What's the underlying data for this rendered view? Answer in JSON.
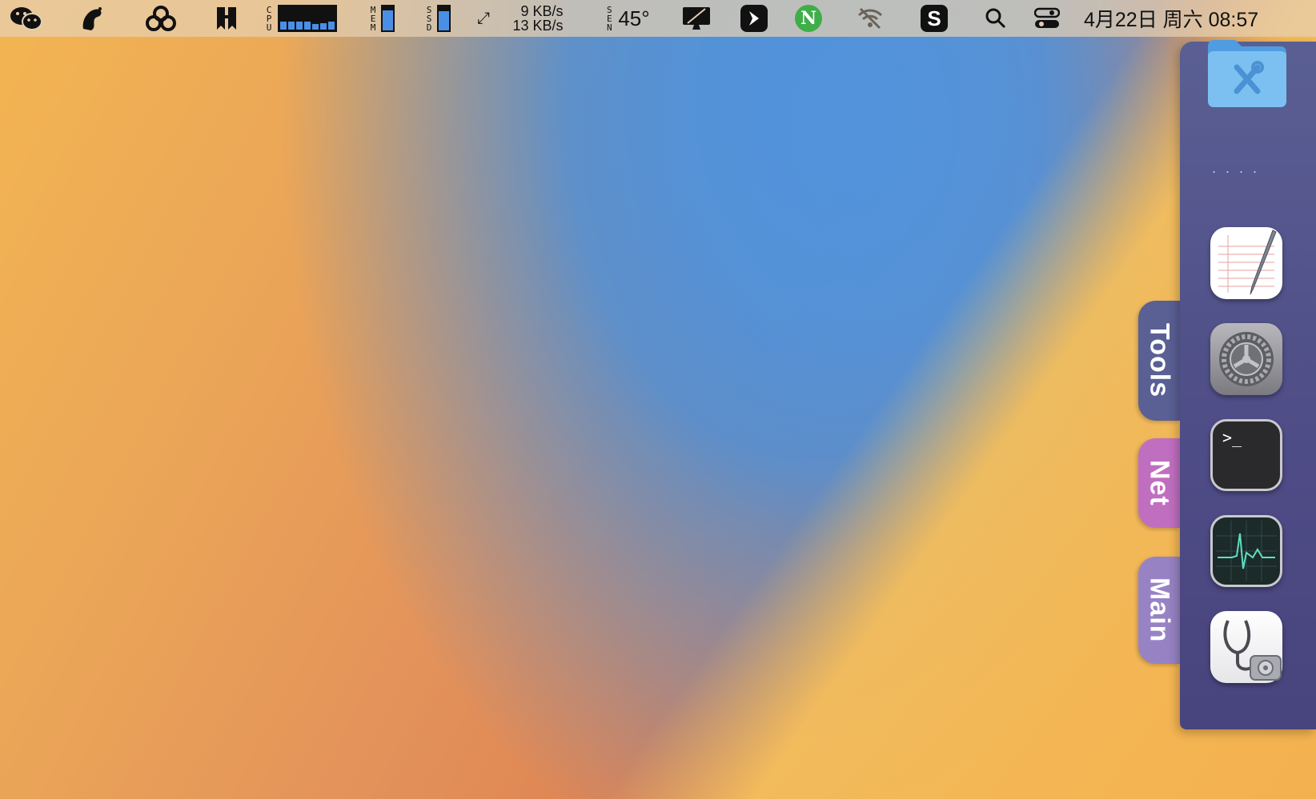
{
  "menubar": {
    "net_up": "9 KB/s",
    "net_down": "13 KB/s",
    "cpu_label": "CPU",
    "mem_label": "MEM",
    "ssd_label": "SSD",
    "sen_label": "SEN",
    "temperature": "45°",
    "clock": "4月22日 周六 08:57",
    "cpu_levels": [
      0.35,
      0.35,
      0.35,
      0.35,
      0.25,
      0.3,
      0.35
    ],
    "mem_level": 0.85,
    "ssd_level": 0.8
  },
  "dock": {
    "tabs": [
      {
        "label": "Tools"
      },
      {
        "label": "Net"
      },
      {
        "label": "Main"
      }
    ],
    "apps": [
      {
        "name": "utilities-folder-icon"
      },
      {
        "name": "textedit-icon"
      },
      {
        "name": "system-preferences-icon"
      },
      {
        "name": "terminal-icon",
        "glyph": ">_"
      },
      {
        "name": "activity-monitor-icon"
      },
      {
        "name": "disk-utility-icon"
      }
    ],
    "separator": "....",
    "accent": "#5a5f93"
  }
}
